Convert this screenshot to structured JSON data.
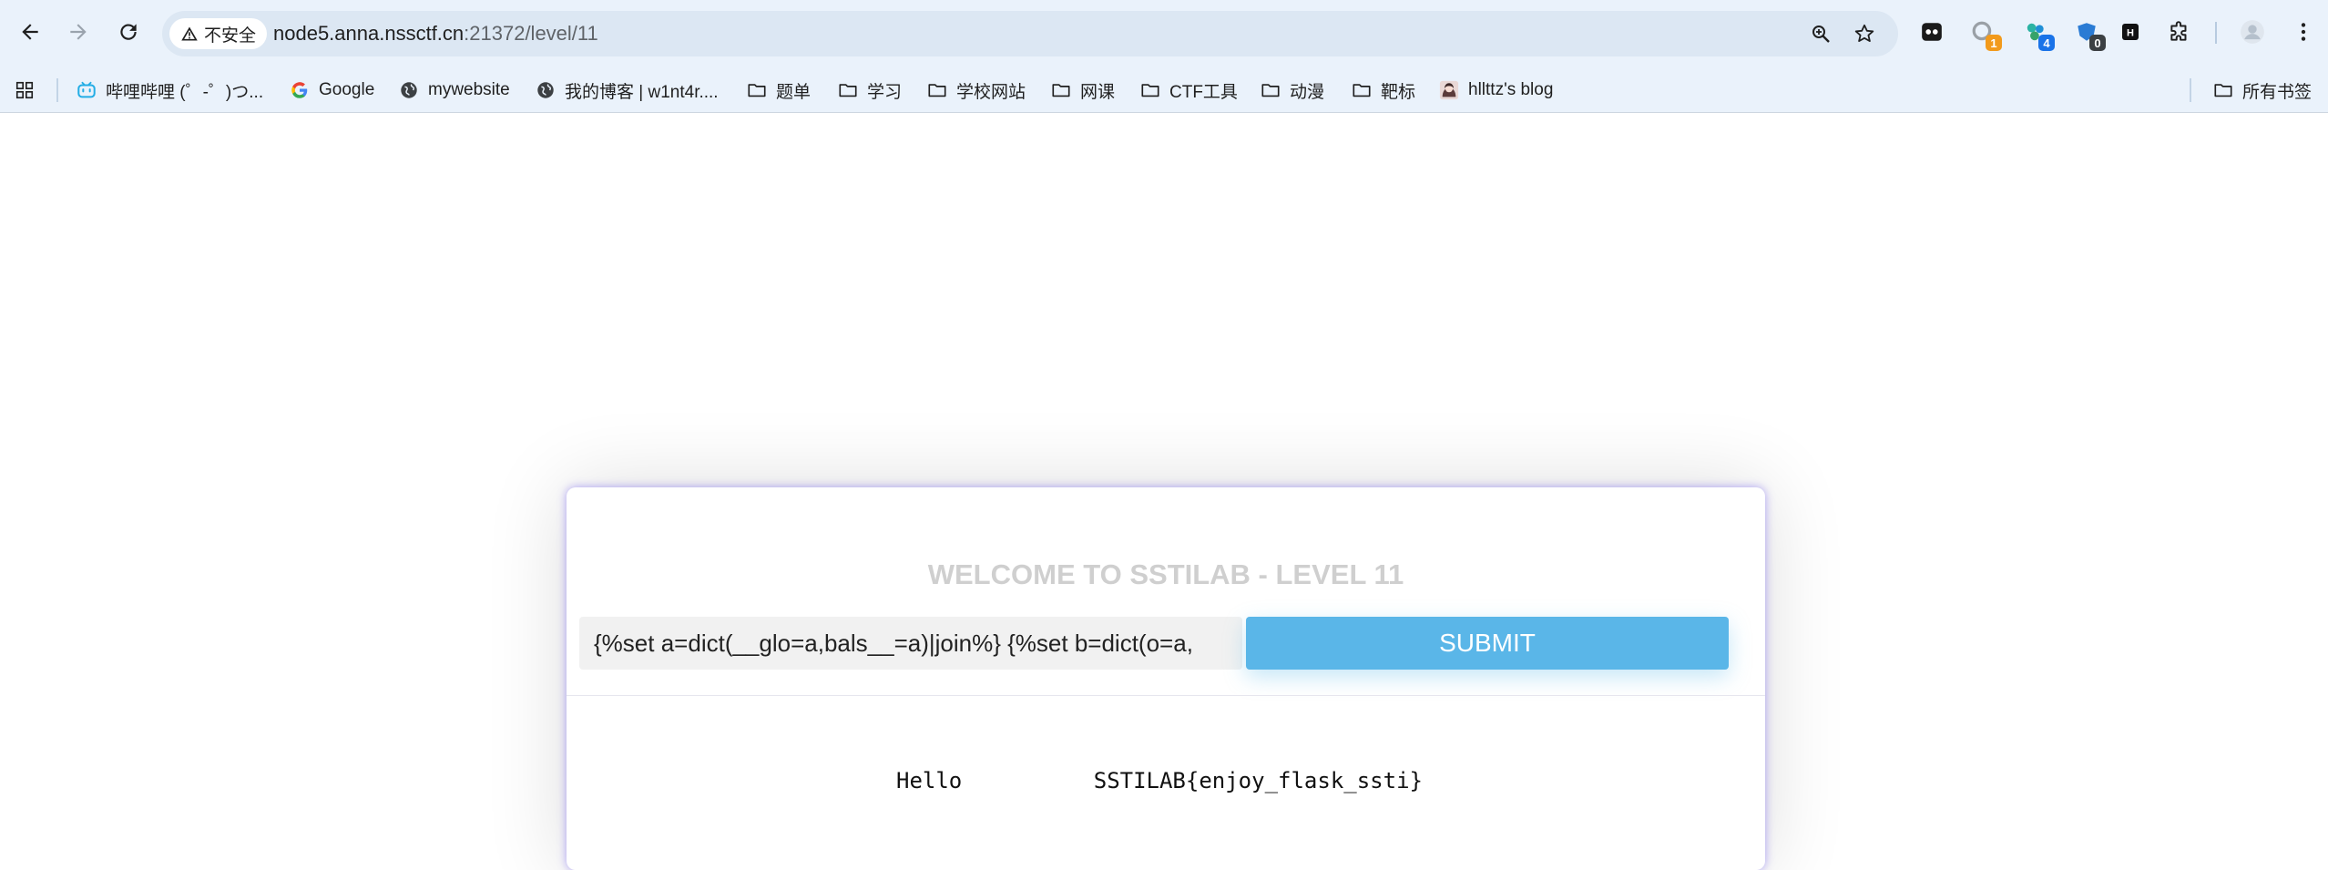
{
  "browser": {
    "security_label": "不安全",
    "url": "node5.anna.nssctf.cn:21372/level/11",
    "url_host": "node5.anna.nssctf.cn",
    "url_path": ":21372/level/11",
    "extensions": [
      {
        "name": "tab-extension",
        "badge": ""
      },
      {
        "name": "search-extension",
        "badge": "1"
      },
      {
        "name": "cookie-extension",
        "badge": "4"
      },
      {
        "name": "hack-extension",
        "badge": "0"
      },
      {
        "name": "hack-bar-extension",
        "badge": ""
      }
    ],
    "accent": "#0b57d0"
  },
  "bookmarks": {
    "items": [
      {
        "label": "哔哩哔哩 (゜-゜)つ...",
        "icon": "bilibili-icon"
      },
      {
        "label": "Google",
        "icon": "google-icon"
      },
      {
        "label": "mywebsite",
        "icon": "globe-icon"
      },
      {
        "label": "我的博客 | w1nt4r....",
        "icon": "globe-icon"
      },
      {
        "label": "题单",
        "icon": "folder-icon"
      },
      {
        "label": "学习",
        "icon": "folder-icon"
      },
      {
        "label": "学校网站",
        "icon": "folder-icon"
      },
      {
        "label": "网课",
        "icon": "folder-icon"
      },
      {
        "label": "CTF工具",
        "icon": "folder-icon"
      },
      {
        "label": "动漫",
        "icon": "folder-icon"
      },
      {
        "label": "靶标",
        "icon": "folder-icon"
      },
      {
        "label": "hllttz's blog",
        "icon": "avatar-icon"
      }
    ],
    "all_bookmarks": "所有书签"
  },
  "card": {
    "title": "WELCOME TO SSTILAB - LEVEL 11",
    "input_value": "{%set a=dict(__glo=a,bals__=a)|join%} {%set b=dict(o=a,",
    "submit_label": "SUBMIT",
    "result": "Hello          SSTILAB{enjoy_flask_ssti}",
    "colors": {
      "title": "#cfcfcf",
      "button": "#5ab6e8",
      "card_glow": "#6e5af0"
    }
  }
}
